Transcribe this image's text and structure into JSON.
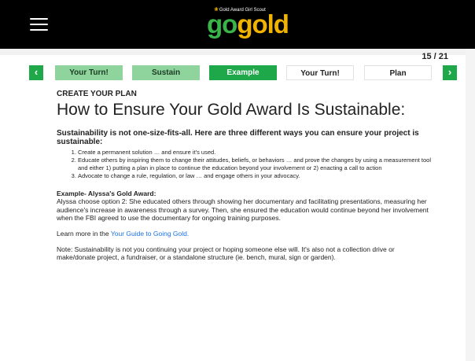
{
  "header": {
    "logo_small": "Gold Award Girl Scout",
    "logo_go": "go",
    "logo_gold": "gold"
  },
  "pager": {
    "counter": "15 / 21"
  },
  "nav": {
    "prev_glyph": "‹",
    "next_glyph": "›",
    "tabs": [
      {
        "label": "Your Turn!",
        "state": "completed"
      },
      {
        "label": "Sustain",
        "state": "completed"
      },
      {
        "label": "Example",
        "state": "active"
      },
      {
        "label": "Your Turn!",
        "state": "upcoming"
      },
      {
        "label": "Plan",
        "state": "upcoming"
      }
    ]
  },
  "content": {
    "eyebrow": "CREATE YOUR PLAN",
    "title": "How to Ensure Your Gold Award Is Sustainable:",
    "subhead": "Sustainability is not one-size-fits-all. Here are three different ways you can ensure your project is sustainable:",
    "list": [
      "Create a permanent solution … and ensure it's used.",
      "Educate others by inspiring them to change their attitudes, beliefs, or behaviors … and prove the changes by using a measurement tool and either 1) putting a plan in place to continue the education beyond your involvement or 2) enacting a call to action",
      "Advocate to change a rule, regulation, or law … and engage others in your advocacy."
    ],
    "example_title": "Example- Alyssa's Gold Award:",
    "example_body": "Alyssa choose option 2: She educated others through showing her documentary and facilitating presentations, measuring her audience's increase in awareness through a survey. Then, she ensured the education would continue beyond her involvement when the FBI agreed to use the documentary for ongoing training purposes.",
    "learn_prefix": "Learn more in the ",
    "learn_link": "Your Guide to Going Gold.",
    "note": "Note: Sustainability is not you continuing your project or hoping someone else will. It's also not a collection drive or make/donate project, a fundraiser, or a standalone structure (ie. bench, mural, sign or garden)."
  },
  "colors": {
    "header_bg": "#000000",
    "brand_green": "#1fa84a",
    "completed_tab": "#8fd39d",
    "brand_gold": "#f0b400",
    "link": "#1a73e8"
  },
  "icons": {
    "menu": "hamburger-menu-icon",
    "prev": "chevron-left-icon",
    "next": "chevron-right-icon"
  }
}
